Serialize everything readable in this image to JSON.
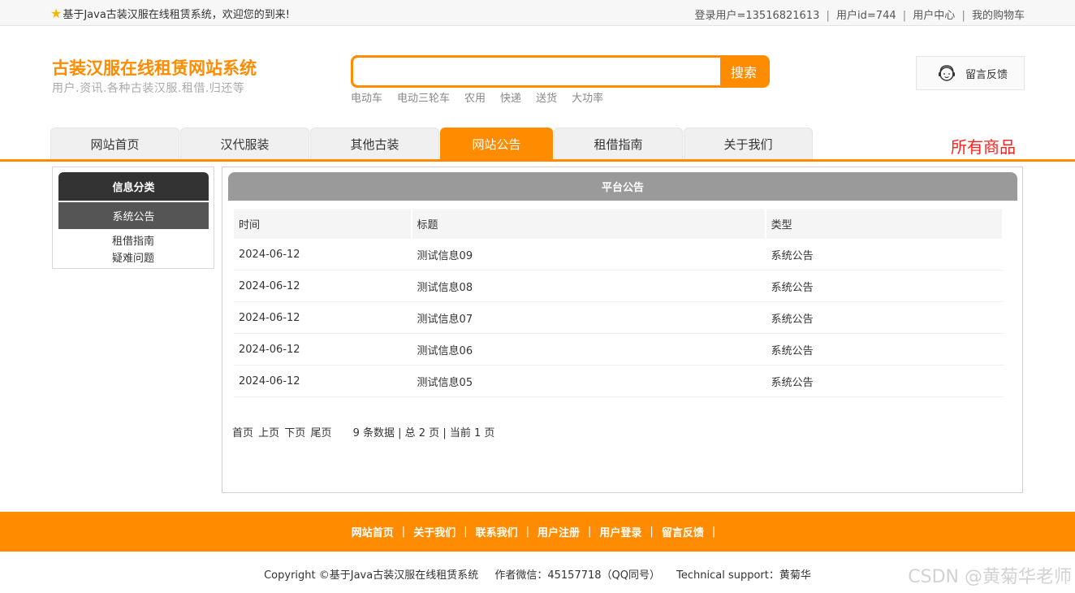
{
  "topbar": {
    "welcome": "基于Java古装汉服在线租赁系统，欢迎您的到来!",
    "login_user": "登录用户=13516821613",
    "user_id": "用户id=744",
    "user_center": "用户中心",
    "cart": "我的购物车",
    "separator": "|"
  },
  "header": {
    "site_title": "古装汉服在线租赁网站系统",
    "site_sub": "用户.资讯.各种古装汉服.租借.归还等",
    "search_button": "搜索",
    "hot_words": [
      "电动车",
      "电动三轮车",
      "农用",
      "快递",
      "送货",
      "大功率"
    ],
    "feedback": "留言反馈"
  },
  "nav": {
    "tabs": [
      {
        "label": "网站首页",
        "active": false
      },
      {
        "label": "汉代服装",
        "active": false
      },
      {
        "label": "其他古装",
        "active": false
      },
      {
        "label": "网站公告",
        "active": true
      },
      {
        "label": "租借指南",
        "active": false
      },
      {
        "label": "关于我们",
        "active": false
      }
    ],
    "all_goods": "所有商品"
  },
  "sidebar": {
    "title": "信息分类",
    "items": [
      "系统公告",
      "租借指南",
      "疑难问题"
    ]
  },
  "panel": {
    "title": "平台公告",
    "columns": [
      "时间",
      "标题",
      "类型"
    ],
    "rows": [
      [
        "2024-06-12",
        "测试信息09",
        "系统公告"
      ],
      [
        "2024-06-12",
        "测试信息08",
        "系统公告"
      ],
      [
        "2024-06-12",
        "测试信息07",
        "系统公告"
      ],
      [
        "2024-06-12",
        "测试信息06",
        "系统公告"
      ],
      [
        "2024-06-12",
        "测试信息05",
        "系统公告"
      ]
    ],
    "pager": {
      "first": "首页",
      "prev": "上页",
      "next": "下页",
      "last": "尾页",
      "info": "9 条数据 | 总 2 页 | 当前 1 页"
    }
  },
  "footer": {
    "links": [
      "网站首页",
      "关于我们",
      "联系我们",
      "用户注册",
      "用户登录",
      "留言反馈"
    ],
    "separator": "|",
    "copyright": "Copyright ©基于Java古装汉服在线租赁系统",
    "author": "作者微信：45157718（QQ同号）",
    "support": "Technical support：黄菊华",
    "watermark": "CSDN @黄菊华老师"
  },
  "colors": {
    "accent": "#ff8c00",
    "all_goods": "#ff2020",
    "sidebar_title": "#333333",
    "sidebar_active": "#555555",
    "panel_title": "#9a9a9a"
  }
}
